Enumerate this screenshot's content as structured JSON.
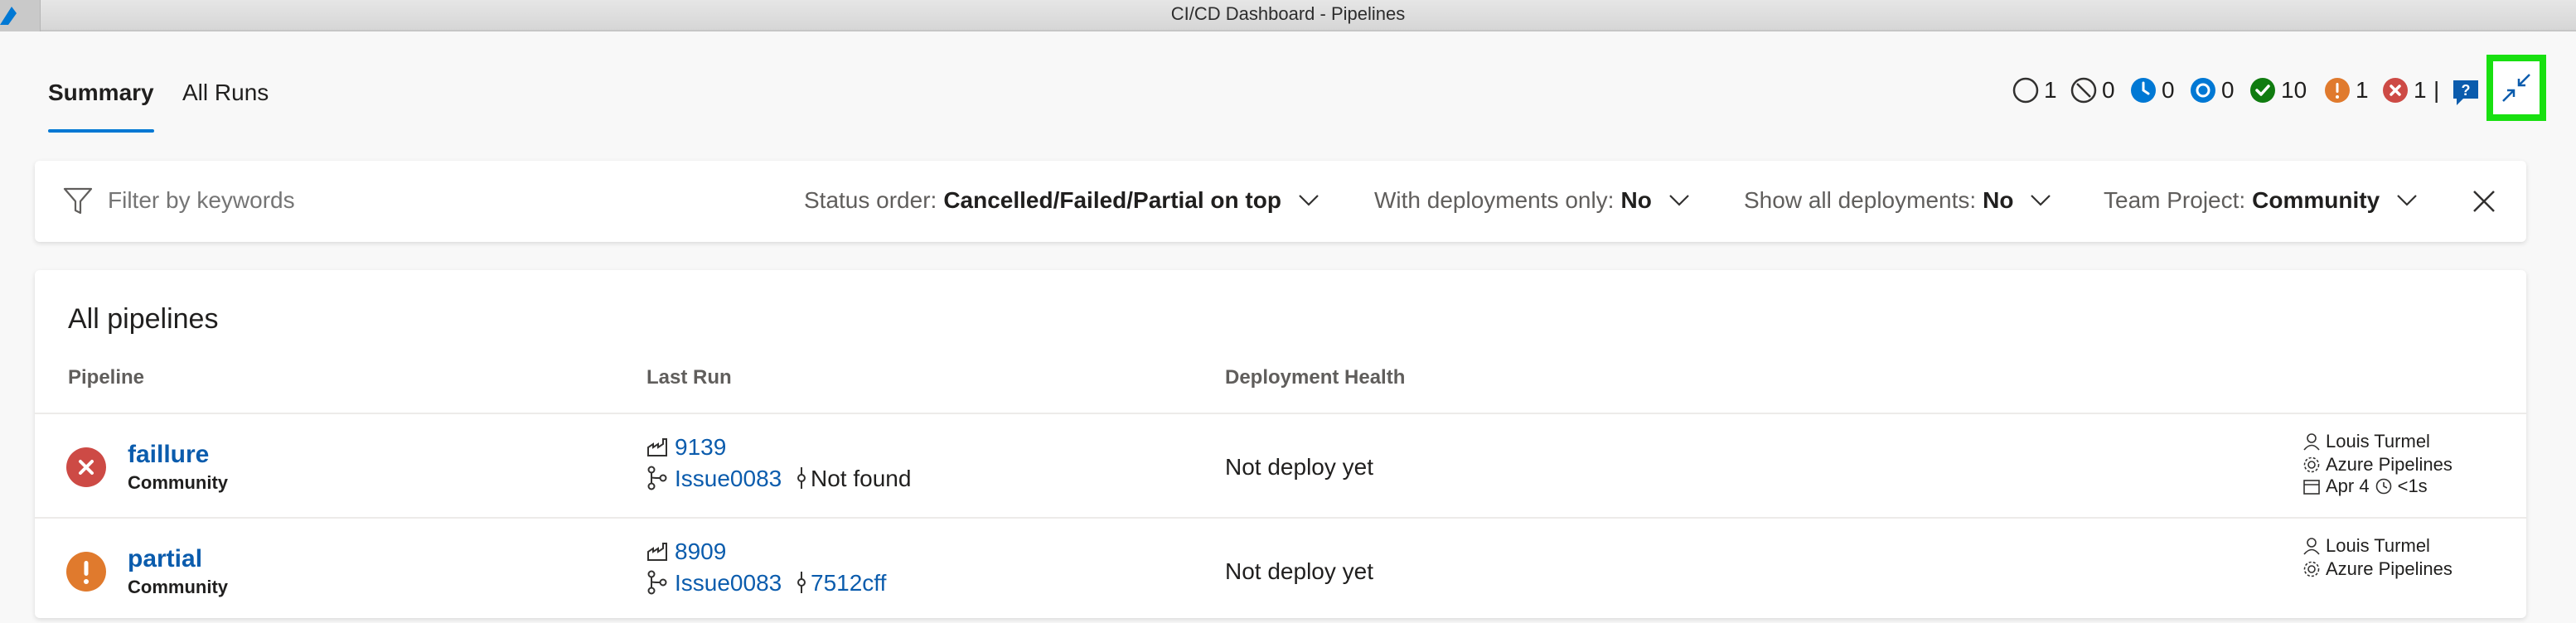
{
  "window": {
    "title": "CI/CD Dashboard - Pipelines"
  },
  "tabs": [
    {
      "label": "Summary",
      "active": true
    },
    {
      "label": "All Runs",
      "active": false
    }
  ],
  "status_counts": [
    {
      "name": "not-started",
      "count": "1",
      "color": "#323130"
    },
    {
      "name": "cancelled",
      "count": "0",
      "color": "#323130"
    },
    {
      "name": "in-progress",
      "count": "0",
      "color": "#0078d4"
    },
    {
      "name": "queued",
      "count": "0",
      "color": "#0078d4"
    },
    {
      "name": "succeeded",
      "count": "10",
      "color": "#107c10"
    },
    {
      "name": "partial",
      "count": "1",
      "color": "#e07a2d"
    },
    {
      "name": "failed",
      "count": "1",
      "color": "#cd4a45"
    }
  ],
  "status_separator": "|",
  "filter": {
    "placeholder": "Filter by keywords",
    "status_order_label": "Status order:",
    "status_order_value": "Cancelled/Failed/Partial on top",
    "deployments_only_label": "With deployments only:",
    "deployments_only_value": "No",
    "show_all_label": "Show all deployments:",
    "show_all_value": "No",
    "team_project_label": "Team Project:",
    "team_project_value": "Community"
  },
  "table": {
    "title": "All pipelines",
    "headers": {
      "pipeline": "Pipeline",
      "last_run": "Last Run",
      "deployment_health": "Deployment Health"
    },
    "rows": [
      {
        "name": "faillure",
        "project": "Community",
        "status": "failed",
        "status_color": "#cd4a45",
        "run_number": "9139",
        "branch": "Issue0083",
        "commit": "Not found",
        "deployment": "Not deploy yet",
        "author": "Louis Turmel",
        "source": "Azure Pipelines",
        "date": "Apr 4",
        "duration": "<1s"
      },
      {
        "name": "partial",
        "project": "Community",
        "status": "partial",
        "status_color": "#e07a2d",
        "run_number": "8909",
        "branch": "Issue0083",
        "commit": "7512cff",
        "deployment": "Not deploy yet",
        "author": "Louis Turmel",
        "source": "Azure Pipelines",
        "date": "",
        "duration": ""
      }
    ]
  }
}
